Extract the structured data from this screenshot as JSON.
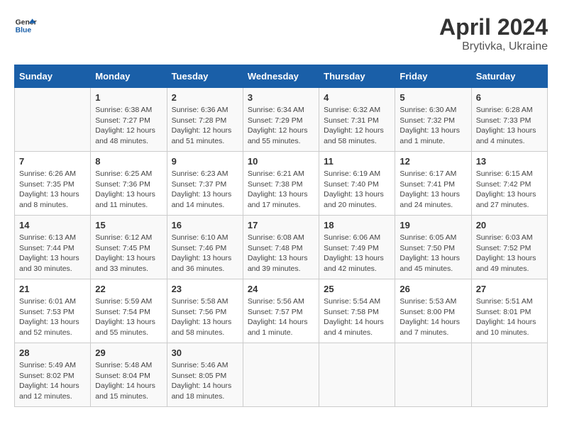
{
  "header": {
    "logo_general": "General",
    "logo_blue": "Blue",
    "title": "April 2024",
    "location": "Brytivka, Ukraine"
  },
  "days_of_week": [
    "Sunday",
    "Monday",
    "Tuesday",
    "Wednesday",
    "Thursday",
    "Friday",
    "Saturday"
  ],
  "weeks": [
    [
      {
        "day": "",
        "content": ""
      },
      {
        "day": "1",
        "content": "Sunrise: 6:38 AM\nSunset: 7:27 PM\nDaylight: 12 hours\nand 48 minutes."
      },
      {
        "day": "2",
        "content": "Sunrise: 6:36 AM\nSunset: 7:28 PM\nDaylight: 12 hours\nand 51 minutes."
      },
      {
        "day": "3",
        "content": "Sunrise: 6:34 AM\nSunset: 7:29 PM\nDaylight: 12 hours\nand 55 minutes."
      },
      {
        "day": "4",
        "content": "Sunrise: 6:32 AM\nSunset: 7:31 PM\nDaylight: 12 hours\nand 58 minutes."
      },
      {
        "day": "5",
        "content": "Sunrise: 6:30 AM\nSunset: 7:32 PM\nDaylight: 13 hours\nand 1 minute."
      },
      {
        "day": "6",
        "content": "Sunrise: 6:28 AM\nSunset: 7:33 PM\nDaylight: 13 hours\nand 4 minutes."
      }
    ],
    [
      {
        "day": "7",
        "content": "Sunrise: 6:26 AM\nSunset: 7:35 PM\nDaylight: 13 hours\nand 8 minutes."
      },
      {
        "day": "8",
        "content": "Sunrise: 6:25 AM\nSunset: 7:36 PM\nDaylight: 13 hours\nand 11 minutes."
      },
      {
        "day": "9",
        "content": "Sunrise: 6:23 AM\nSunset: 7:37 PM\nDaylight: 13 hours\nand 14 minutes."
      },
      {
        "day": "10",
        "content": "Sunrise: 6:21 AM\nSunset: 7:38 PM\nDaylight: 13 hours\nand 17 minutes."
      },
      {
        "day": "11",
        "content": "Sunrise: 6:19 AM\nSunset: 7:40 PM\nDaylight: 13 hours\nand 20 minutes."
      },
      {
        "day": "12",
        "content": "Sunrise: 6:17 AM\nSunset: 7:41 PM\nDaylight: 13 hours\nand 24 minutes."
      },
      {
        "day": "13",
        "content": "Sunrise: 6:15 AM\nSunset: 7:42 PM\nDaylight: 13 hours\nand 27 minutes."
      }
    ],
    [
      {
        "day": "14",
        "content": "Sunrise: 6:13 AM\nSunset: 7:44 PM\nDaylight: 13 hours\nand 30 minutes."
      },
      {
        "day": "15",
        "content": "Sunrise: 6:12 AM\nSunset: 7:45 PM\nDaylight: 13 hours\nand 33 minutes."
      },
      {
        "day": "16",
        "content": "Sunrise: 6:10 AM\nSunset: 7:46 PM\nDaylight: 13 hours\nand 36 minutes."
      },
      {
        "day": "17",
        "content": "Sunrise: 6:08 AM\nSunset: 7:48 PM\nDaylight: 13 hours\nand 39 minutes."
      },
      {
        "day": "18",
        "content": "Sunrise: 6:06 AM\nSunset: 7:49 PM\nDaylight: 13 hours\nand 42 minutes."
      },
      {
        "day": "19",
        "content": "Sunrise: 6:05 AM\nSunset: 7:50 PM\nDaylight: 13 hours\nand 45 minutes."
      },
      {
        "day": "20",
        "content": "Sunrise: 6:03 AM\nSunset: 7:52 PM\nDaylight: 13 hours\nand 49 minutes."
      }
    ],
    [
      {
        "day": "21",
        "content": "Sunrise: 6:01 AM\nSunset: 7:53 PM\nDaylight: 13 hours\nand 52 minutes."
      },
      {
        "day": "22",
        "content": "Sunrise: 5:59 AM\nSunset: 7:54 PM\nDaylight: 13 hours\nand 55 minutes."
      },
      {
        "day": "23",
        "content": "Sunrise: 5:58 AM\nSunset: 7:56 PM\nDaylight: 13 hours\nand 58 minutes."
      },
      {
        "day": "24",
        "content": "Sunrise: 5:56 AM\nSunset: 7:57 PM\nDaylight: 14 hours\nand 1 minute."
      },
      {
        "day": "25",
        "content": "Sunrise: 5:54 AM\nSunset: 7:58 PM\nDaylight: 14 hours\nand 4 minutes."
      },
      {
        "day": "26",
        "content": "Sunrise: 5:53 AM\nSunset: 8:00 PM\nDaylight: 14 hours\nand 7 minutes."
      },
      {
        "day": "27",
        "content": "Sunrise: 5:51 AM\nSunset: 8:01 PM\nDaylight: 14 hours\nand 10 minutes."
      }
    ],
    [
      {
        "day": "28",
        "content": "Sunrise: 5:49 AM\nSunset: 8:02 PM\nDaylight: 14 hours\nand 12 minutes."
      },
      {
        "day": "29",
        "content": "Sunrise: 5:48 AM\nSunset: 8:04 PM\nDaylight: 14 hours\nand 15 minutes."
      },
      {
        "day": "30",
        "content": "Sunrise: 5:46 AM\nSunset: 8:05 PM\nDaylight: 14 hours\nand 18 minutes."
      },
      {
        "day": "",
        "content": ""
      },
      {
        "day": "",
        "content": ""
      },
      {
        "day": "",
        "content": ""
      },
      {
        "day": "",
        "content": ""
      }
    ]
  ]
}
